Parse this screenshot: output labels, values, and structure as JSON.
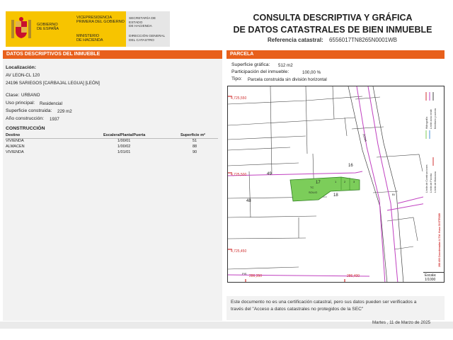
{
  "header": {
    "gobierno": [
      "GOBIERNO",
      "DE ESPAÑA"
    ],
    "vicepresidencia": [
      "VICEPRESIDENCIA",
      "PRIMERA DEL GOBIERNO"
    ],
    "ministerio": [
      "MINISTERIO",
      "DE HACIENDA"
    ],
    "secretaria": [
      "SECRETARÍA DE ESTADO",
      "DE HACIENDA"
    ],
    "direccion": [
      "DIRECCIÓN GENERAL",
      "DEL CATASTRO"
    ],
    "title_line1": "CONSULTA DESCRIPTIVA Y GRÁFICA",
    "title_line2": "DE DATOS CATASTRALES DE BIEN INMUEBLE",
    "ref_label": "Referencia catastral:",
    "ref_value": "6556017TN8265N0001WB"
  },
  "left": {
    "section_title": "DATOS DESCRIPTIVOS DEL INMUEBLE",
    "localizacion_label": "Localización:",
    "address1": "AV LEON-CL 120",
    "address2": "24196 SARIEGOS [CARBAJAL LEGUA] [LEÓN]",
    "clase_label": "Clase:",
    "clase_value": "URBANO",
    "uso_label": "Uso principal:",
    "uso_value": "Residencial",
    "sup_label": "Superficie construida:",
    "sup_value": "229 m2",
    "anio_label": "Año construcción:",
    "anio_value": "1937",
    "construccion_title": "CONSTRUCCIÓN",
    "table_headers": [
      "Destino",
      "Escalera/Planta/Puerta",
      "Superficie m²"
    ],
    "rows": [
      [
        "VIVIENDA",
        "1/00/01",
        "51"
      ],
      [
        "ALMACEN",
        "1/00/02",
        "88"
      ],
      [
        "VIVIENDA",
        "1/01/01",
        "90"
      ]
    ]
  },
  "right": {
    "section_title": "PARCELA",
    "sup_label": "Superficie gráfica:",
    "sup_value": "512 m2",
    "part_label": "Participación del inmueble:",
    "part_value": "100,00 %",
    "tipo_label": "Tipo:",
    "tipo_value": "Parcela construida sin división horizontal"
  },
  "map": {
    "y_labels": [
      "4,725,550",
      "4,725,500",
      "4,725,450"
    ],
    "x_labels": [
      "286,350",
      "286,400"
    ],
    "parcel_numbers": [
      "49",
      "16",
      "17",
      "18",
      "48"
    ],
    "tc_label": "TC",
    "parcel_small": [
      "1",
      "2",
      "3"
    ],
    "parcel_code": "SOL/O",
    "side_label": "ZONA",
    "small_labels": [
      "PIS",
      "BI"
    ],
    "vertical_text": "286 400 Coordenadas U.T.M. Huso 30 ETRS89",
    "legend": [
      "Límite de Manzana",
      "Límite de Parcela",
      "Límite de Construcciones",
      "Mobiliario y aceras",
      "Límite zona verde",
      "Hidrografía"
    ],
    "escala_label": "Escala:",
    "escala_value": "1/1000"
  },
  "note": {
    "line1": "Este documento no es una certificación catastral, pero sus datos pueden ser verificados a",
    "line2": "través del \"Acceso a datos catastrales no protegidos de la SEC\""
  },
  "footer": {
    "date": "Martes , 11 de Marzo de 2025"
  },
  "colors": {
    "accent": "#e8601c",
    "logo_yellow": "#f7c400",
    "parcel_green": "#7ccd5a",
    "limit_magenta": "#c040c0"
  }
}
